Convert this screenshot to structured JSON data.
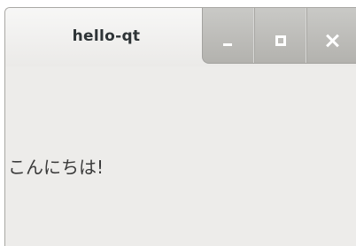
{
  "window": {
    "title": "hello-qt",
    "controls": {
      "minimize_icon": "minimize-icon",
      "maximize_icon": "maximize-icon",
      "close_icon": "close-icon"
    }
  },
  "content": {
    "label": "こんにちは!"
  },
  "colors": {
    "window_background": "#edecea",
    "titlebar_controls": "#b3b2ae",
    "title_text": "#2e3436",
    "icon_glyph": "#ffffff"
  }
}
